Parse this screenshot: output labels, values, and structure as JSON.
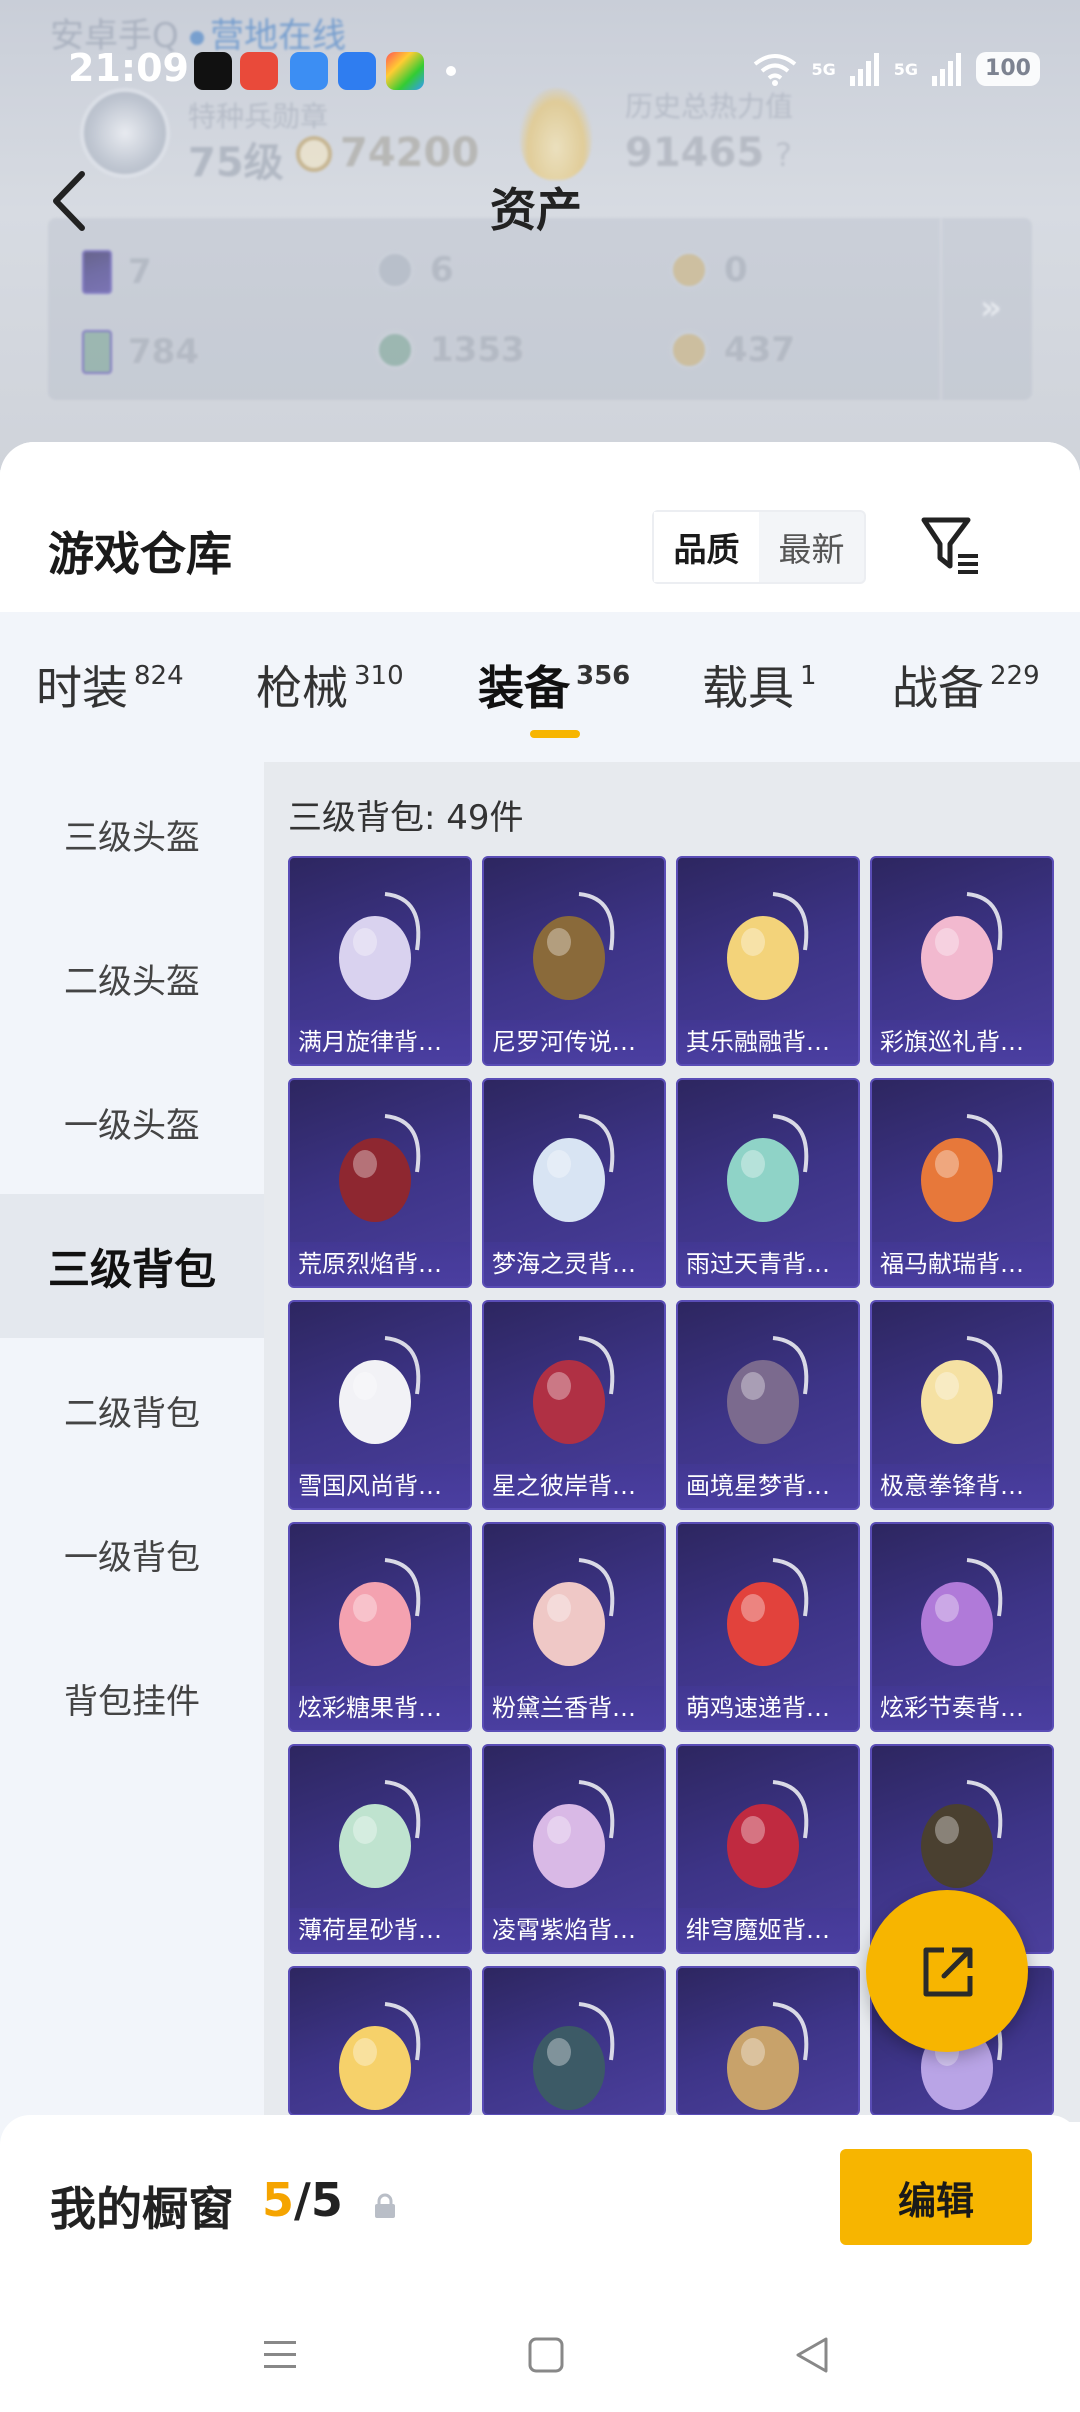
{
  "status_bar": {
    "time": "21:09",
    "battery": "100",
    "signal_1": "5G",
    "signal_2": "5G"
  },
  "background": {
    "app_name": "安卓手Q",
    "online_status": "营地在线",
    "rank_label": "特种兵勋章",
    "level": "75级",
    "points": "74200",
    "heat_label": "历史总热力值",
    "heat_value": "91465",
    "help": "?"
  },
  "header": {
    "title": "资产"
  },
  "assets": {
    "items": [
      {
        "value": "7",
        "icon": "card-icon"
      },
      {
        "value": "6",
        "icon": "silver-coin-icon"
      },
      {
        "value": "0",
        "icon": "gold-coin-icon"
      },
      {
        "value": "784",
        "icon": "green-card-icon"
      },
      {
        "value": "1353",
        "icon": "green-coin-icon"
      },
      {
        "value": "437",
        "icon": "bronze-coin-icon"
      }
    ],
    "more": "»"
  },
  "warehouse": {
    "title": "游戏仓库",
    "sort_options": [
      "品质",
      "最新"
    ],
    "sort_selected": "品质"
  },
  "tabs": [
    {
      "label": "时装",
      "count": "824"
    },
    {
      "label": "枪械",
      "count": "310"
    },
    {
      "label": "装备",
      "count": "356"
    },
    {
      "label": "载具",
      "count": "1"
    },
    {
      "label": "战备",
      "count": "229"
    }
  ],
  "sidebar": {
    "items": [
      "三级头盔",
      "二级头盔",
      "一级头盔",
      "三级背包",
      "二级背包",
      "一级背包",
      "背包挂件"
    ],
    "selected": "三级背包"
  },
  "content": {
    "title": "三级背包: 49件",
    "items": [
      {
        "name": "满月旋律背包...",
        "color": "#d9d2ef"
      },
      {
        "name": "尼罗河传说背...",
        "color": "#8a6a3a"
      },
      {
        "name": "其乐融融背包...",
        "color": "#f3d37a"
      },
      {
        "name": "彩旗巡礼背包...",
        "color": "#f2b9cf"
      },
      {
        "name": "荒原烈焰背包...",
        "color": "#8e2730"
      },
      {
        "name": "梦海之灵背包...",
        "color": "#d8e4f3"
      },
      {
        "name": "雨过天青背包...",
        "color": "#8fd3c7"
      },
      {
        "name": "福马献瑞背包...",
        "color": "#e7783a"
      },
      {
        "name": "雪国风尚背包...",
        "color": "#f2f2f6"
      },
      {
        "name": "星之彼岸背包...",
        "color": "#b03044"
      },
      {
        "name": "画境星梦背包...",
        "color": "#7b6a8e"
      },
      {
        "name": "极意拳锋背包...",
        "color": "#f5e1a3"
      },
      {
        "name": "炫彩糖果背包...",
        "color": "#f4a2b0"
      },
      {
        "name": "粉黛兰香背包...",
        "color": "#efc8c6"
      },
      {
        "name": "萌鸡速递背包...",
        "color": "#e2423c"
      },
      {
        "name": "炫彩节奏背包...",
        "color": "#b07ad9"
      },
      {
        "name": "薄荷星砂背包...",
        "color": "#bfe3cf"
      },
      {
        "name": "凌霄紫焰背包...",
        "color": "#d9b9e6"
      },
      {
        "name": "绯穹魔姬背包...",
        "color": "#c02a40"
      },
      {
        "name": "",
        "color": "#4a4030"
      },
      {
        "name": "",
        "color": "#f6d16a"
      },
      {
        "name": "",
        "color": "#3c5a66"
      },
      {
        "name": "",
        "color": "#c8a26a"
      },
      {
        "name": "",
        "color": "#b9a4e6"
      }
    ]
  },
  "showcase": {
    "label": "我的橱窗",
    "current": "5",
    "separator": "/",
    "total": "5",
    "edit_label": "编辑"
  }
}
